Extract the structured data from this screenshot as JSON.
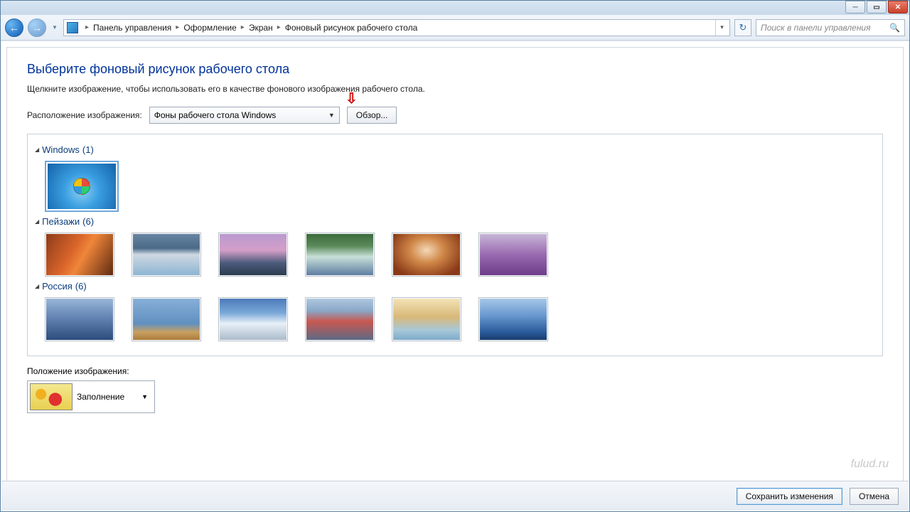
{
  "breadcrumb": {
    "items": [
      "Панель управления",
      "Оформление",
      "Экран",
      "Фоновый рисунок рабочего стола"
    ]
  },
  "search": {
    "placeholder": "Поиск в панели управления"
  },
  "page": {
    "title": "Выберите фоновый рисунок рабочего стола",
    "subtitle": "Щелкните изображение, чтобы использовать его в качестве фонового изображения рабочего стола."
  },
  "location": {
    "label": "Расположение изображения:",
    "selected": "Фоны рабочего стола Windows",
    "browse_label": "Обзор..."
  },
  "groups": [
    {
      "name": "Windows",
      "count": 1
    },
    {
      "name": "Пейзажи",
      "count": 6
    },
    {
      "name": "Россия",
      "count": 6
    }
  ],
  "position": {
    "label": "Положение изображения:",
    "selected": "Заполнение"
  },
  "footer": {
    "save_label": "Сохранить изменения",
    "cancel_label": "Отмена"
  },
  "watermark": "fulud.ru"
}
